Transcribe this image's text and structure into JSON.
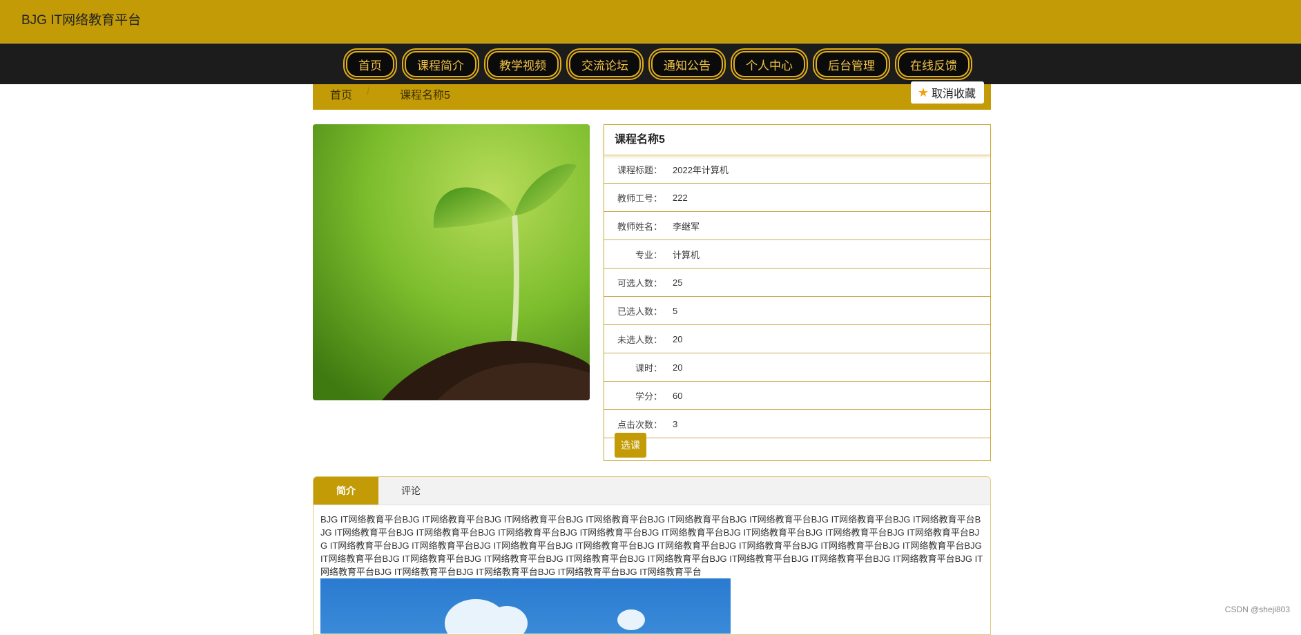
{
  "site": {
    "title": "BJG IT网络教育平台"
  },
  "nav": {
    "items": [
      "首页",
      "课程简介",
      "教学视频",
      "交流论坛",
      "通知公告",
      "个人中心",
      "后台管理",
      "在线反馈"
    ]
  },
  "breadcrumb": {
    "home": "首页",
    "separator": "/",
    "current": "课程名称5"
  },
  "favorite": {
    "label": "取消收藏",
    "icon": "star-icon"
  },
  "course": {
    "name": "课程名称5",
    "fields": [
      {
        "label": "课程标题：",
        "value": "2022年计算机"
      },
      {
        "label": "教师工号：",
        "value": "222"
      },
      {
        "label": "教师姓名：",
        "value": "李继军"
      },
      {
        "label": "专业：",
        "value": "计算机"
      },
      {
        "label": "可选人数：",
        "value": "25"
      },
      {
        "label": "已选人数：",
        "value": "5"
      },
      {
        "label": "未选人数：",
        "value": "20"
      },
      {
        "label": "课时：",
        "value": "20"
      },
      {
        "label": "学分：",
        "value": "60"
      },
      {
        "label": "点击次数：",
        "value": "3"
      }
    ],
    "select_label": "选课"
  },
  "tabs": {
    "items": [
      "简介",
      "评论"
    ],
    "active": 0,
    "intro_text": "BJG IT网络教育平台BJG IT网络教育平台BJG IT网络教育平台BJG IT网络教育平台BJG IT网络教育平台BJG IT网络教育平台BJG IT网络教育平台BJG IT网络教育平台BJG IT网络教育平台BJG IT网络教育平台BJG IT网络教育平台BJG IT网络教育平台BJG IT网络教育平台BJG IT网络教育平台BJG IT网络教育平台BJG IT网络教育平台BJG IT网络教育平台BJG IT网络教育平台BJG IT网络教育平台BJG IT网络教育平台BJG IT网络教育平台BJG IT网络教育平台BJG IT网络教育平台BJG IT网络教育平台BJG IT网络教育平台BJG IT网络教育平台BJG IT网络教育平台BJG IT网络教育平台BJG IT网络教育平台BJG IT网络教育平台BJG IT网络教育平台BJG IT网络教育平台BJG IT网络教育平台BJG IT网络教育平台BJG IT网络教育平台BJG IT网络教育平台BJG IT网络教育平台"
  },
  "watermark": "CSDN @sheji803",
  "colors": {
    "accent": "#c39b06",
    "nav_bg": "#1c1c1c",
    "nav_text": "#f0c245"
  }
}
